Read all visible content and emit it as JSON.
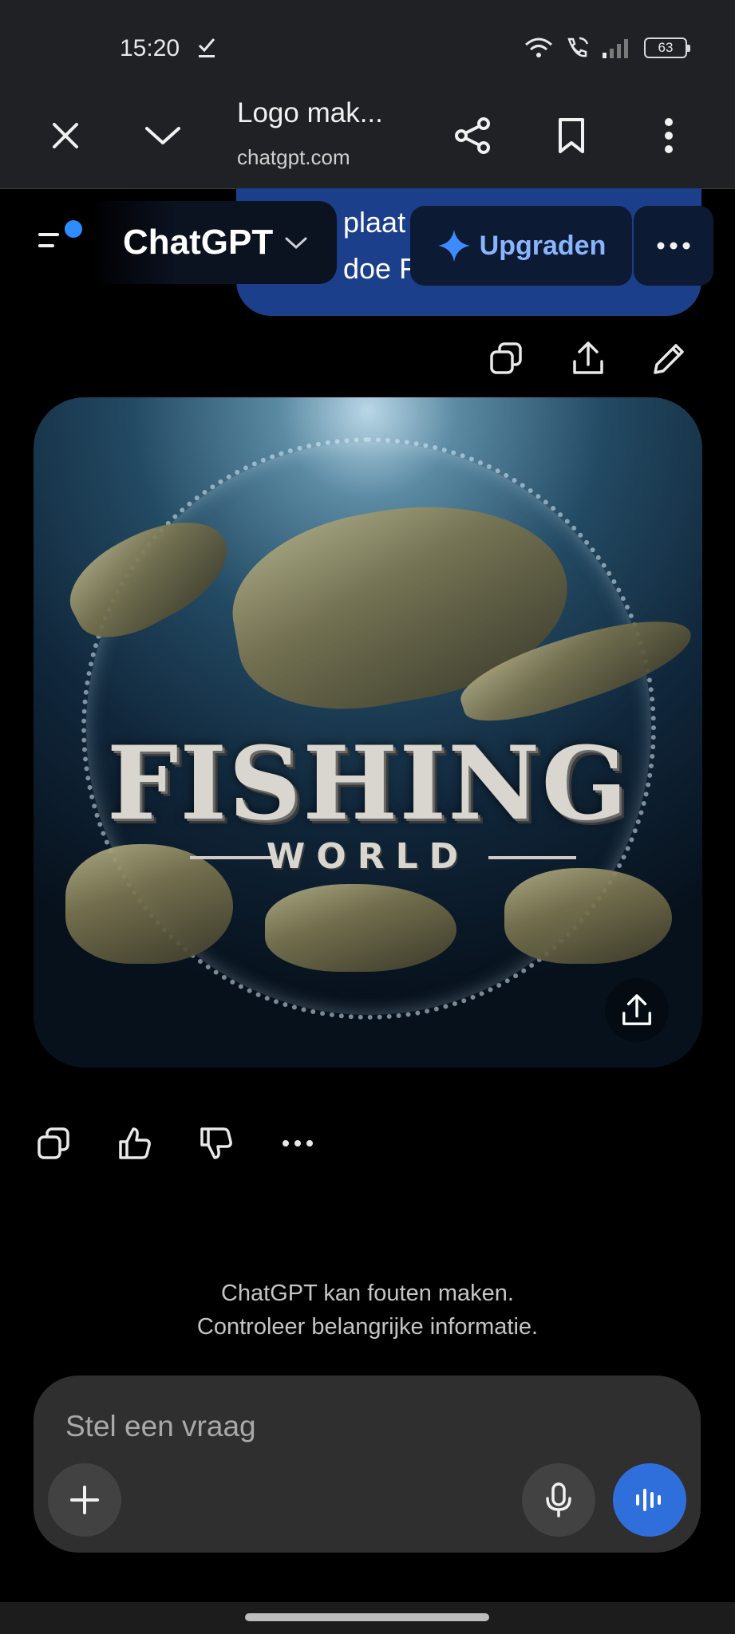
{
  "status_bar": {
    "time": "15:20",
    "battery": "63",
    "icons": [
      "download-done-icon",
      "wifi-icon",
      "wifi-calling-icon",
      "signal-icon",
      "battery-icon"
    ]
  },
  "browser": {
    "page_title": "Logo mak...",
    "url": "chatgpt.com",
    "icons": [
      "close-icon",
      "chevron-down-icon",
      "share-icon",
      "bookmark-icon",
      "more-vert-icon"
    ]
  },
  "header": {
    "brand": "ChatGPT",
    "upgrade_label": "Upgraden",
    "user_message_line1": "plaat",
    "user_message_line2": "doe F"
  },
  "image": {
    "title": "FISHING",
    "subtitle": "WORLD"
  },
  "footer": {
    "disclaimer_line1": "ChatGPT kan fouten maken.",
    "disclaimer_line2": "Controleer belangrijke informatie."
  },
  "composer": {
    "placeholder": "Stel een vraag"
  },
  "colors": {
    "accent": "#2f6fdb",
    "upgrade_text": "#89b4ff",
    "bubble": "#1b3f8a",
    "notification_dot": "#2e8cff"
  }
}
